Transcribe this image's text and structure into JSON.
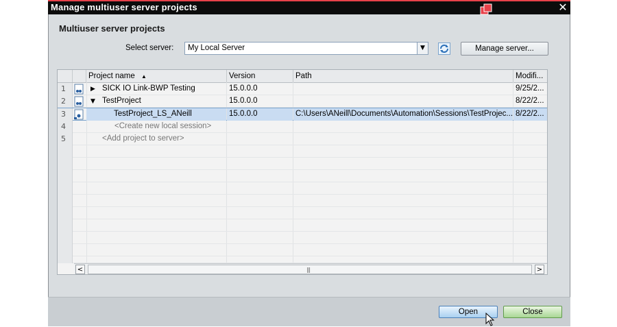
{
  "window": {
    "title": "Manage multiuser server projects",
    "close_glyph": "✕"
  },
  "section_title": "Multiuser server projects",
  "server": {
    "label": "Select server:",
    "value": "My Local Server",
    "dropdown_glyph": "▼",
    "manage_button": "Manage server..."
  },
  "grid": {
    "columns": [
      "Project name",
      "Version",
      "Path",
      "Modifi..."
    ],
    "sort_glyph": "▲",
    "rows": [
      {
        "num": "1",
        "name": "SICK IO Link-BWP Testing",
        "version": "15.0.0.0",
        "path": "",
        "modified": "9/25/2...",
        "toggle": "▶"
      },
      {
        "num": "2",
        "name": "TestProject",
        "version": "15.0.0.0",
        "path": "",
        "modified": "8/22/2...",
        "toggle": "▼"
      },
      {
        "num": "3",
        "name": "TestProject_LS_ANeill",
        "version": "15.0.0.0",
        "path": "C:\\Users\\ANeill\\Documents\\Automation\\Sessions\\TestProjec...",
        "modified": "8/22/2..."
      },
      {
        "num": "4",
        "name": "<Create new local session>"
      },
      {
        "num": "5",
        "name": "<Add project to server>"
      }
    ],
    "scroll_left": "<",
    "scroll_right": ">",
    "scroll_grip": "|||"
  },
  "buttons": {
    "open": "Open",
    "close": "Close"
  },
  "colors": {
    "title_bar": "#0c0c0c",
    "selection": "#c9dcf2",
    "open_btn": "#a9d0f0",
    "close_btn": "#a9d795"
  }
}
